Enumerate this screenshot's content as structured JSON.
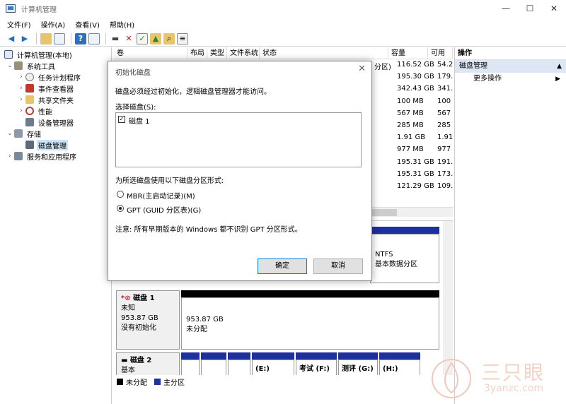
{
  "window": {
    "title": "计算机管理",
    "min": "—",
    "max": "☐",
    "close": "✕"
  },
  "menu": [
    "文件(F)",
    "操作(A)",
    "查看(V)",
    "帮助(H)"
  ],
  "toolbar_icons": [
    "back-arrow-icon",
    "forward-arrow-icon",
    "up-folder-icon",
    "properties-icon",
    "help-icon",
    "view-icon",
    "connect-icon",
    "delete-icon",
    "check-icon",
    "folder-up-icon",
    "search-icon",
    "list-icon"
  ],
  "tree": {
    "root": "计算机管理(本地)",
    "items": [
      {
        "label": "系统工具",
        "level": 1,
        "arrow": "⌄"
      },
      {
        "label": "任务计划程序",
        "level": 2,
        "arrow": "›"
      },
      {
        "label": "事件查看器",
        "level": 2,
        "arrow": "›"
      },
      {
        "label": "共享文件夹",
        "level": 2,
        "arrow": "›"
      },
      {
        "label": "性能",
        "level": 2,
        "arrow": "›"
      },
      {
        "label": "设备管理器",
        "level": 2,
        "arrow": ""
      },
      {
        "label": "存储",
        "level": 1,
        "arrow": "⌄"
      },
      {
        "label": "磁盘管理",
        "level": 2,
        "arrow": "",
        "selected": true
      },
      {
        "label": "服务和应用程序",
        "level": 1,
        "arrow": "›"
      }
    ]
  },
  "volume_table": {
    "columns": [
      "卷",
      "布局",
      "类型",
      "文件系统",
      "状态",
      "容量",
      "可用"
    ],
    "partial_status": "分区)",
    "capacity": [
      "116.52 GB",
      "195.30 GB",
      "342.43 GB",
      "100 MB",
      "567 MB",
      "285 MB",
      "1.91 GB",
      "977 MB",
      "195.31 GB",
      "195.31 GB",
      "121.29 GB"
    ],
    "free": [
      "54.2",
      "179.",
      "341.",
      "100",
      "567",
      "285",
      "1.91",
      "977",
      "191.",
      "173.",
      "109."
    ]
  },
  "disk0_partial": {
    "fs": "NTFS",
    "desc": "基本数据分区"
  },
  "disk1": {
    "name": "磁盘 1",
    "type": "未知",
    "size": "953.87 GB",
    "status": "没有初始化",
    "part_size": "953.87 GB",
    "part_status": "未分配"
  },
  "disk2": {
    "name": "磁盘 2",
    "type": "基本",
    "parts": [
      "",
      "",
      "",
      "(E:)",
      "考试 (F:)",
      "测评 (G:)",
      "(H:)"
    ]
  },
  "legend": {
    "unallocated": "未分配",
    "primary": "主分区"
  },
  "actions": {
    "header": "操作",
    "section": "磁盘管理",
    "more": "更多操作"
  },
  "dialog": {
    "title": "初始化磁盘",
    "intro": "磁盘必须经过初始化，逻辑磁盘管理器才能访问。",
    "select_label": "选择磁盘(S):",
    "disk_item": "磁盘 1",
    "scheme_label": "为所选磁盘使用以下磁盘分区形式:",
    "mbr": "MBR(主启动记录)(M)",
    "gpt": "GPT (GUID 分区表)(G)",
    "note": "注意: 所有早期版本的 Windows 都不识别 GPT 分区形式。",
    "ok": "确定",
    "cancel": "取消"
  },
  "watermark": {
    "brand": "三只眼",
    "site": "3yanzc.com"
  },
  "colors": {
    "primary": "#1e2f9e",
    "unallocated": "#000000",
    "selection": "#cce4f7",
    "accent": "#0078d7"
  }
}
